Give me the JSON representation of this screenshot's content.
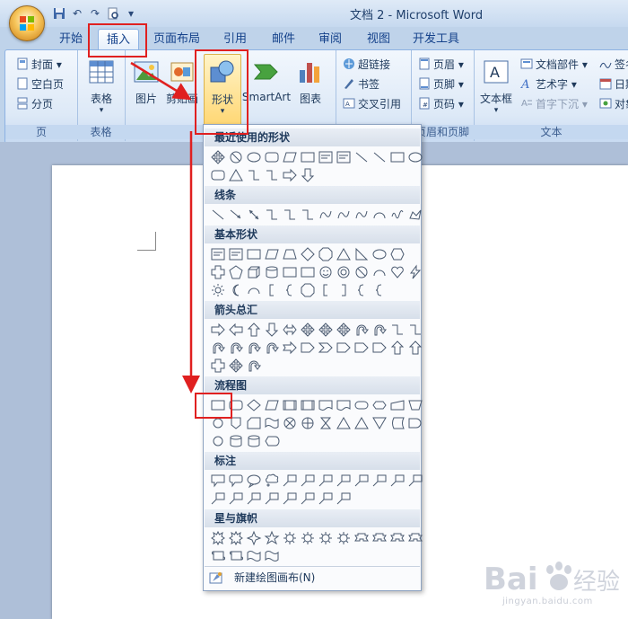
{
  "app": {
    "title": "文档 2 - Microsoft Word"
  },
  "tabs": [
    {
      "label": "开始"
    },
    {
      "label": "插入",
      "active": true
    },
    {
      "label": "页面布局"
    },
    {
      "label": "引用"
    },
    {
      "label": "邮件"
    },
    {
      "label": "审阅"
    },
    {
      "label": "视图"
    },
    {
      "label": "开发工具"
    }
  ],
  "ribbon": {
    "pages": {
      "label": "页",
      "items": [
        "封面",
        "空白页",
        "分页"
      ]
    },
    "tables": {
      "label": "表格",
      "button": "表格"
    },
    "illustrations": {
      "picture": "图片",
      "clipart": "剪贴画",
      "shapes": "形状",
      "smartart": "SmartArt",
      "chart": "图表"
    },
    "links": {
      "items": [
        "超链接",
        "书签",
        "交叉引用"
      ]
    },
    "header_footer": {
      "label": "页眉和页脚",
      "items": [
        "页眉",
        "页脚",
        "页码"
      ]
    },
    "text": {
      "label": "文本",
      "textbox": "文本框",
      "items": [
        "文档部件",
        "艺术字",
        "首字下沉"
      ],
      "right_items": [
        "签名",
        "日期",
        "对象"
      ]
    }
  },
  "shapes_menu": {
    "categories": [
      {
        "title": "最近使用的形状"
      },
      {
        "title": "线条"
      },
      {
        "title": "基本形状"
      },
      {
        "title": "箭头总汇"
      },
      {
        "title": "流程图"
      },
      {
        "title": "标注"
      },
      {
        "title": "星与旗帜"
      }
    ],
    "new_canvas": "新建绘图画布(N)"
  },
  "watermark": {
    "brand": "Baidu经验",
    "url": "jingyan.baidu.com"
  },
  "colors": {
    "highlight": "#e02020",
    "ribbon_text": "#15428b"
  }
}
